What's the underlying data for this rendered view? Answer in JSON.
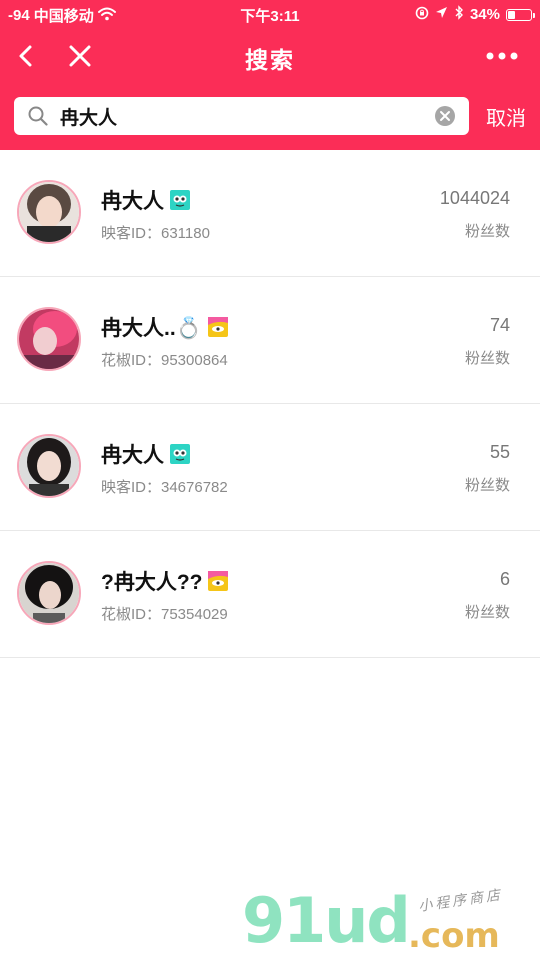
{
  "status_bar": {
    "signal": "-94",
    "carrier": "中国移动",
    "time": "下午3:11",
    "battery": "34%",
    "battery_level": 0.34
  },
  "nav": {
    "title": "搜索",
    "back_icon": "chevron-left-icon",
    "close_icon": "close-icon",
    "more_icon": "more-dots-icon"
  },
  "search": {
    "value": "冉大人",
    "cancel_label": "取消"
  },
  "colors": {
    "brand": "#fb2d57",
    "avatar_ring": "#f7a7b9",
    "badge_yingke": "#2dd4c4",
    "badge_huajiao": "#f5c518"
  },
  "results": [
    {
      "name": "冉大人",
      "badge": "yingke-app-icon",
      "id_label": "映客ID：631180",
      "fans": "1044024",
      "fans_label": "粉丝数"
    },
    {
      "name": "冉大人..💍",
      "badge": "huajiao-app-icon",
      "id_label": "花椒ID：95300864",
      "fans": "74",
      "fans_label": "粉丝数"
    },
    {
      "name": "冉大人",
      "badge": "yingke-app-icon",
      "id_label": "映客ID：34676782",
      "fans": "55",
      "fans_label": "粉丝数"
    },
    {
      "name": "?冉大人??",
      "badge": "huajiao-app-icon",
      "id_label": "花椒ID：75354029",
      "fans": "6",
      "fans_label": "粉丝数"
    }
  ],
  "watermark": {
    "logo": "91ud",
    "domain": ".com",
    "tagline": "小程序商店"
  }
}
